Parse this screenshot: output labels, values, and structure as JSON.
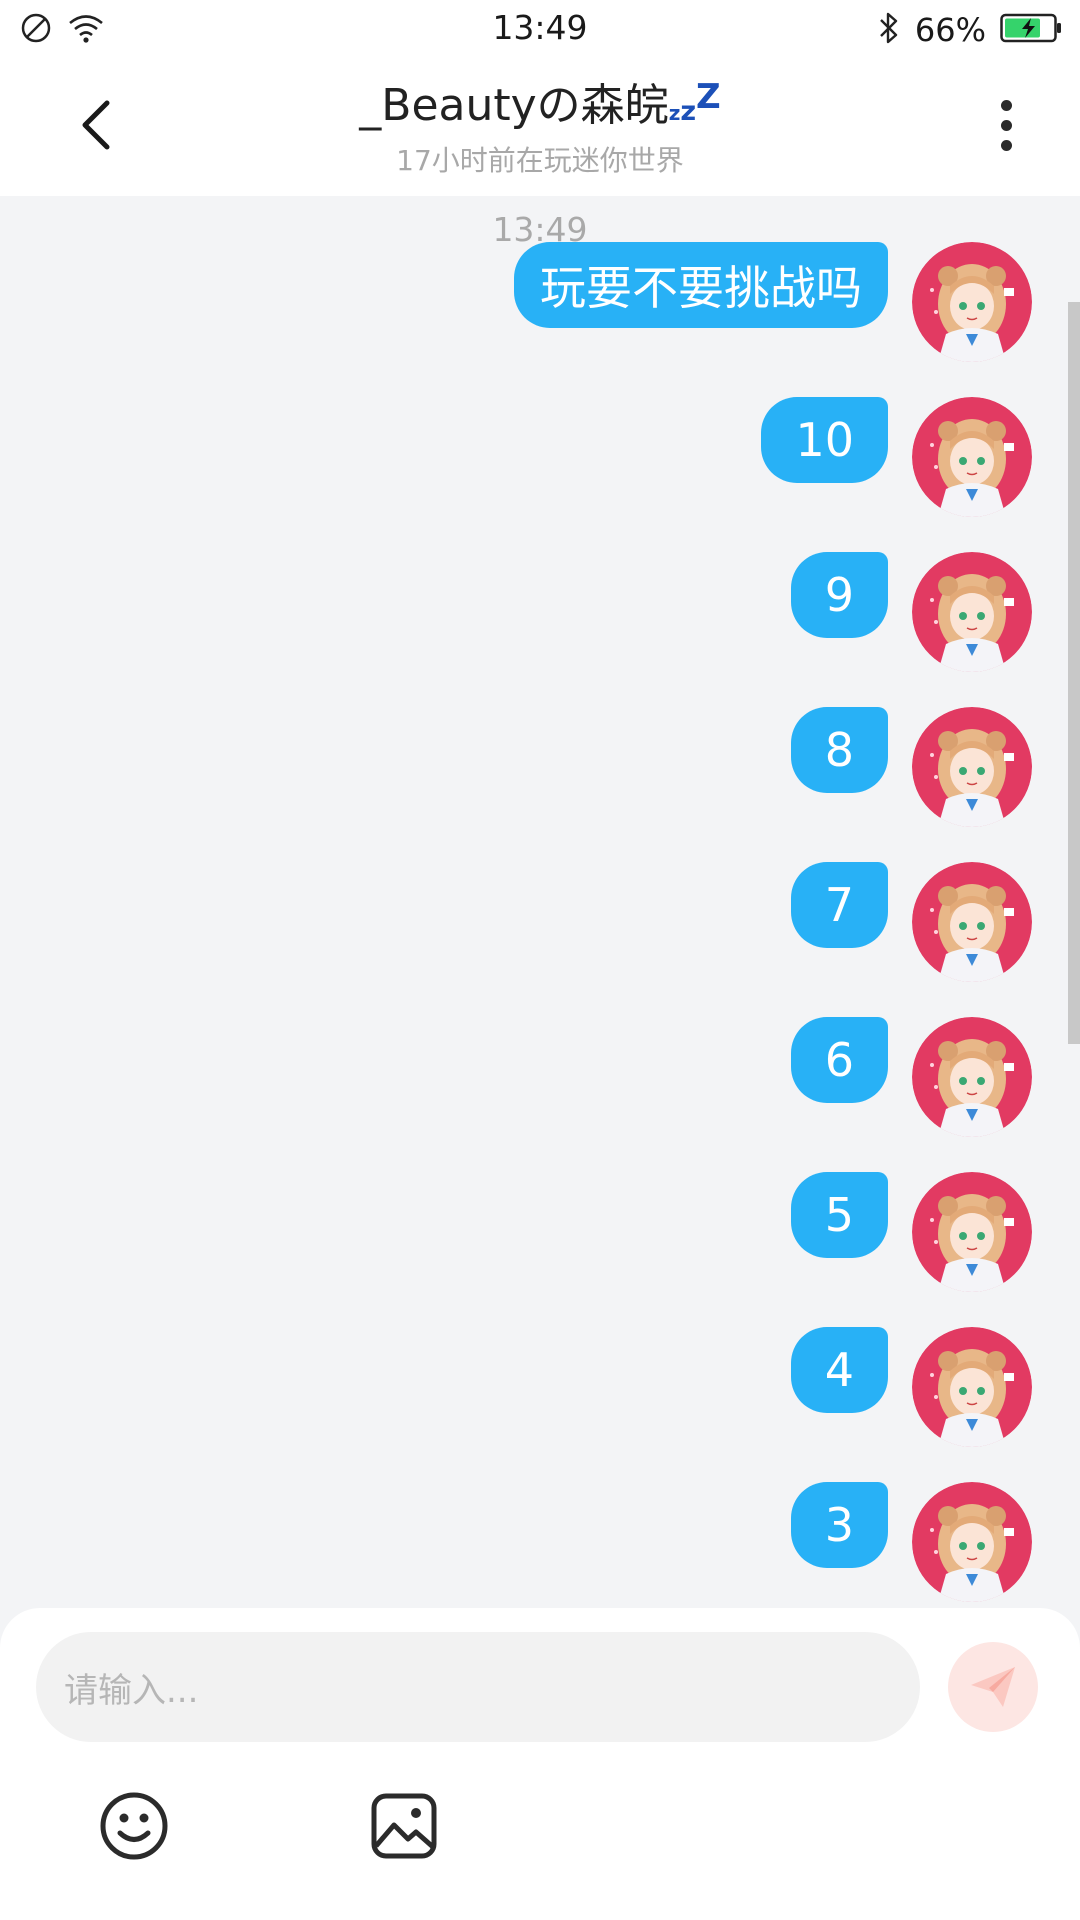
{
  "status_bar": {
    "time": "13:49",
    "battery": "66%",
    "icons": [
      "do-not-disturb-icon",
      "wifi-icon",
      "bluetooth-icon",
      "battery-charging-icon"
    ]
  },
  "header": {
    "title": "_Beautyの森皖",
    "title_suffix": [
      "z",
      "z",
      "Z"
    ],
    "subtitle": "17小时前在玩迷你世界"
  },
  "chat": {
    "timestamp": "13:49",
    "bubble_color": "#28b1f6",
    "messages": [
      {
        "text": "玩要不要挑战吗",
        "from": "me"
      },
      {
        "text": "10",
        "from": "me"
      },
      {
        "text": "9",
        "from": "me"
      },
      {
        "text": "8",
        "from": "me"
      },
      {
        "text": "7",
        "from": "me"
      },
      {
        "text": "6",
        "from": "me"
      },
      {
        "text": "5",
        "from": "me"
      },
      {
        "text": "4",
        "from": "me"
      },
      {
        "text": "3",
        "from": "me"
      }
    ]
  },
  "composer": {
    "placeholder": "请输入...",
    "send_icon": "send-icon",
    "tools": [
      "emoji-icon",
      "image-icon"
    ]
  },
  "colors": {
    "accent": "#28b1f6",
    "avatar_bg": "#e23a62",
    "send_button_bg": "#fde6e3"
  }
}
